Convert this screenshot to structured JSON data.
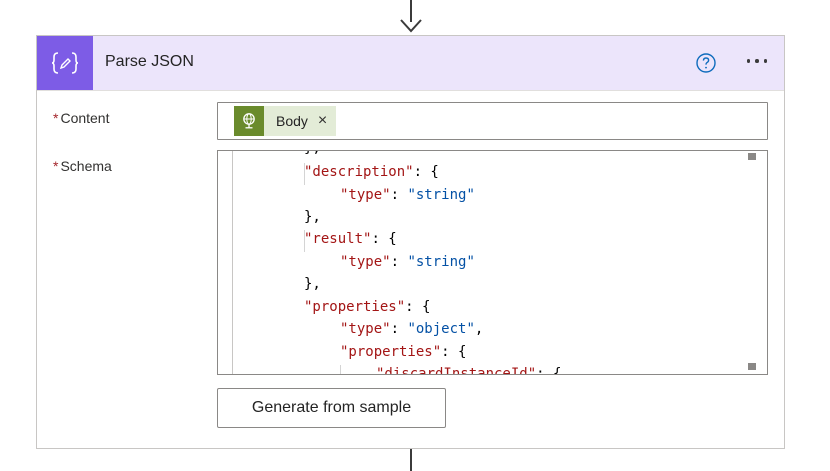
{
  "card": {
    "title": "Parse JSON",
    "action_icon": "braces-pen-icon",
    "help_icon": "question-circle-icon",
    "more_icon": "ellipsis-icon",
    "accent_color": "#7d5ce6",
    "header_bg": "#ece5fb"
  },
  "fields": {
    "content": {
      "required_mark": "*",
      "label": "Content",
      "token": {
        "label": "Body",
        "remove": "×",
        "icon": "globe-icon",
        "color": "#6a8b2c"
      }
    },
    "schema": {
      "required_mark": "*",
      "label": "Schema",
      "lines": [
        [
          {
            "t": "},",
            "c": "p"
          }
        ],
        [
          {
            "t": "\"description\"",
            "c": "k"
          },
          {
            "t": ": {",
            "c": "p"
          }
        ],
        [
          {
            "t": "\"type\"",
            "c": "k"
          },
          {
            "t": ": ",
            "c": "p"
          },
          {
            "t": "\"string\"",
            "c": "s"
          }
        ],
        [
          {
            "t": "},",
            "c": "p"
          }
        ],
        [
          {
            "t": "\"result\"",
            "c": "k"
          },
          {
            "t": ": {",
            "c": "p"
          }
        ],
        [
          {
            "t": "\"type\"",
            "c": "k"
          },
          {
            "t": ": ",
            "c": "p"
          },
          {
            "t": "\"string\"",
            "c": "s"
          }
        ],
        [
          {
            "t": "},",
            "c": "p"
          }
        ],
        [
          {
            "t": "\"properties\"",
            "c": "k"
          },
          {
            "t": ": {",
            "c": "p"
          }
        ],
        [
          {
            "t": "\"type\"",
            "c": "k"
          },
          {
            "t": ": ",
            "c": "p"
          },
          {
            "t": "\"object\"",
            "c": "s"
          },
          {
            "t": ",",
            "c": "p"
          }
        ],
        [
          {
            "t": "\"properties\"",
            "c": "k"
          },
          {
            "t": ": {",
            "c": "p"
          }
        ],
        [
          {
            "t": "\"discardInstanceId\"",
            "c": "k"
          },
          {
            "t": ": {",
            "c": "p"
          }
        ]
      ]
    }
  },
  "generate_button": {
    "label": "Generate from sample"
  }
}
